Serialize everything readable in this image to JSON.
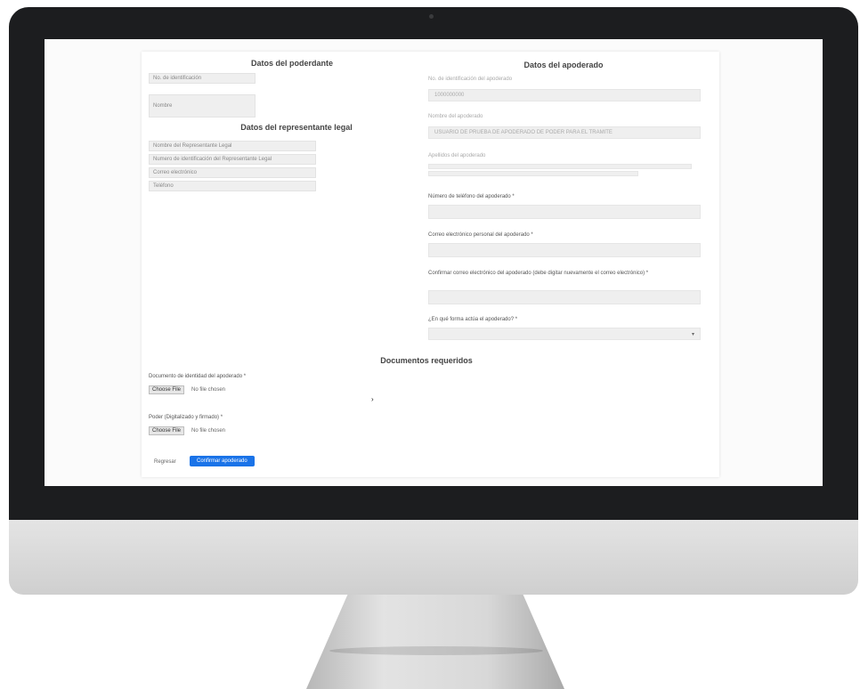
{
  "poderdante": {
    "title": "Datos del poderdante",
    "id_label": "No. de identificación",
    "name_label": "Nombre"
  },
  "representante": {
    "title": "Datos del representante legal",
    "fields": [
      "Nombre del Representante Legal",
      "Numero de identificación del Representante Legal",
      "Correo electrónico",
      "Teléfono"
    ]
  },
  "apoderado": {
    "title": "Datos del apoderado",
    "id_label": "No. de identificación del apoderado",
    "id_value": "1000000000",
    "name_label": "Nombre del apoderado",
    "name_value": "USUARIO DE PRUEBA DE APODERADO DE PODER PARA EL TRAMITE",
    "lastname_label": "Apellidos del apoderado",
    "phone_label": "Número de teléfono del apoderado *",
    "email_label": "Correo electrónico personal del apoderado *",
    "confirm_email_label": "Confirmar correo electrónico del apoderado (debe digitar nuevamente el correo electrónico) *",
    "role_label": "¿En qué forma actúa el apoderado? *"
  },
  "documentos": {
    "title": "Documentos requeridos",
    "doc1_label": "Documento de identidad del apoderado *",
    "doc2_label": "Poder (Digitalizado y firmado) *",
    "choose_file": "Choose File",
    "no_file": "No file chosen"
  },
  "actions": {
    "back": "Regresar",
    "confirm": "Confirmar apoderado"
  },
  "colors": {
    "primary": "#1a73e8"
  }
}
